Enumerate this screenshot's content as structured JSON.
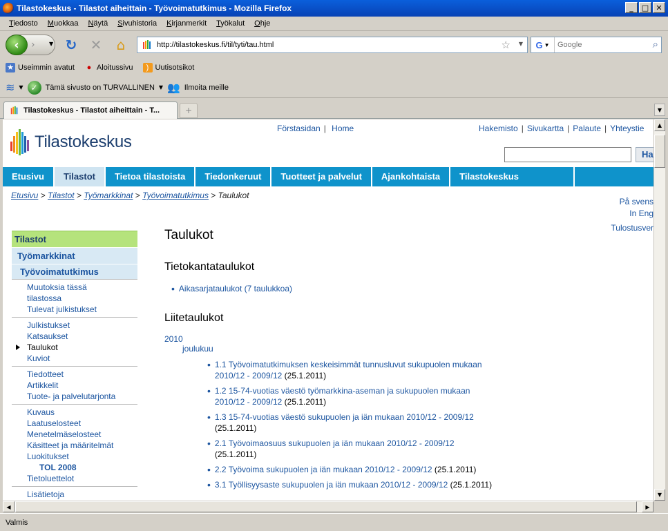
{
  "window": {
    "title": "Tilastokeskus - Tilastot aiheittain - Työvoimatutkimus - Mozilla Firefox"
  },
  "menu": [
    "Tiedosto",
    "Muokkaa",
    "Näytä",
    "Sivuhistoria",
    "Kirjanmerkit",
    "Työkalut",
    "Ohje"
  ],
  "nav": {
    "url": "http://tilastokeskus.fi/til/tyti/tau.html",
    "search_placeholder": "Google"
  },
  "bookmarks": [
    "Useimmin avatut",
    "Aloitussivu",
    "Uutisotsikot"
  ],
  "addons": {
    "safe_text": "Tämä sivusto on TURVALLINEN",
    "report_text": "Ilmoita meille"
  },
  "tab": {
    "title": "Tilastokeskus - Tilastot aiheittain - T..."
  },
  "status": "Valmis",
  "page": {
    "logo_text": "Tilastokeskus",
    "toplinks_left": [
      "Förstasidan",
      "Home"
    ],
    "toplinks_right": [
      "Hakemisto",
      "Sivukartta",
      "Palaute",
      "Yhteystie"
    ],
    "search_button": "Ha",
    "mainnav": [
      "Etusivu",
      "Tilastot",
      "Tietoa tilastoista",
      "Tiedonkeruut",
      "Tuotteet ja palvelut",
      "Ajankohtaista",
      "Tilastokeskus"
    ],
    "breadcrumb": [
      "Etusivu",
      "Tilastot",
      "Työmarkkinat",
      "Työvoimatutkimus"
    ],
    "breadcrumb_current": "Taulukot",
    "lang_links": [
      "På svens",
      "In Eng"
    ],
    "print_link": "Tulostusver",
    "sidebar": {
      "head": "Tilastot",
      "level1": "Työmarkkinat",
      "level2": "Työvoimatutkimus",
      "groups": [
        [
          "Muutoksia tässä tilastossa",
          "Tulevat julkistukset"
        ],
        [
          "Julkistukset",
          "Katsaukset",
          "Taulukot",
          "Kuviot"
        ],
        [
          "Tiedotteet",
          "Artikkelit",
          "Tuote- ja palvelutarjonta"
        ],
        [
          "Kuvaus",
          "Laatuselosteet",
          "Menetelmäselosteet",
          "Käsitteet ja määritelmät",
          "Luokitukset",
          "TOL 2008",
          "Tietoluettelot"
        ],
        [
          "Lisätietoja"
        ]
      ]
    },
    "main": {
      "title": "Taulukot",
      "db_heading": "Tietokantataulukot",
      "db_link": "Aikasarjataulukot (7 taulukkoa)",
      "app_heading": "Liitetaulukot",
      "year": "2010",
      "month": "joulukuu",
      "tables": [
        {
          "l1": "1.1 Työvoimatutkimuksen keskeisimmät tunnusluvut sukupuolen mukaan",
          "l2": "2010/12 - 2009/12",
          "date": " (25.1.2011)"
        },
        {
          "l1": "1.2 15-74-vuotias väestö työmarkkina-aseman ja sukupuolen mukaan",
          "l2": "2010/12 - 2009/12",
          "date": " (25.1.2011)"
        },
        {
          "l1": "1.3 15-74-vuotias väestö sukupuolen ja iän mukaan 2010/12 - 2009/12",
          "l2": "",
          "date": "(25.1.2011)"
        },
        {
          "l1": "2.1 Työvoimaosuus sukupuolen ja iän mukaan 2010/12 - 2009/12",
          "l2": "",
          "date": "(25.1.2011)"
        },
        {
          "l1": "2.2 Työvoima sukupuolen ja iän mukaan 2010/12 - 2009/12",
          "l2": "",
          "date": " (25.1.2011)"
        },
        {
          "l1": "3.1 Työllisyysaste sukupuolen ja iän mukaan 2010/12 - 2009/12",
          "l2": "",
          "date": " (25.1.2011)"
        }
      ]
    }
  }
}
